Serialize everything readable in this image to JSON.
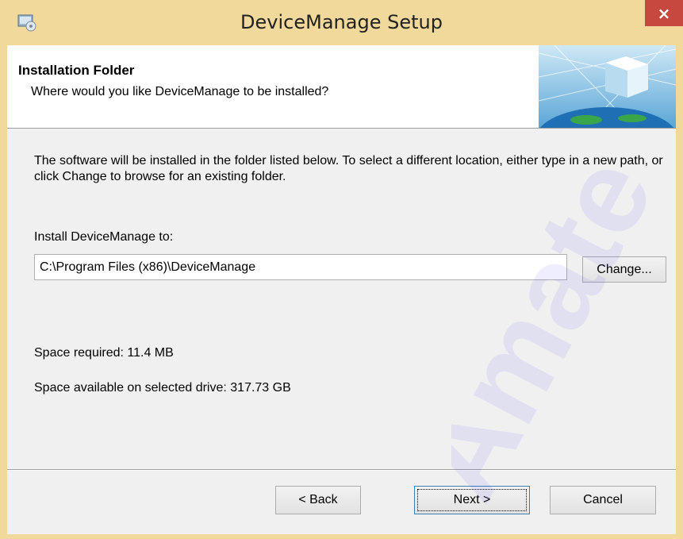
{
  "window": {
    "title": "DeviceManage Setup",
    "close_glyph": "×"
  },
  "banner": {
    "title": "Installation Folder",
    "subtitle": "Where would you like DeviceManage to be installed?"
  },
  "body": {
    "description": "The software will be installed in the folder listed below. To select a different location, either type in a new path, or click Change to browse for an existing folder.",
    "install_label": "Install DeviceManage to:",
    "install_path": "C:\\Program Files (x86)\\DeviceManage",
    "change_label": "Change...",
    "space_required": "Space required: 11.4 MB",
    "space_available": "Space available on selected drive: 317.73 GB"
  },
  "buttons": {
    "back": "< Back",
    "next": "Next >",
    "cancel": "Cancel"
  },
  "watermark_text": "Amate",
  "colors": {
    "titlebar": "#f0d99a",
    "close": "#c7483f",
    "dialog_bg": "#f0f0f0",
    "watermark": "#1a1aff"
  }
}
